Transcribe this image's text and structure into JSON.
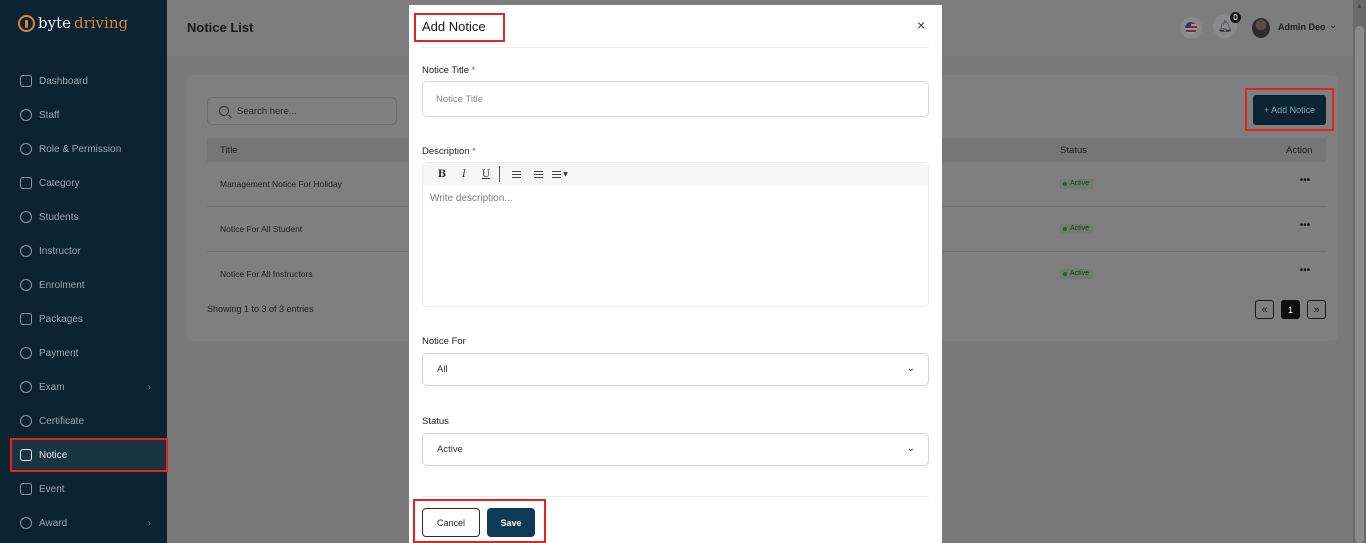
{
  "app": {
    "brand_part1": "byte",
    "brand_part2": "driving"
  },
  "sidebar": {
    "items": [
      {
        "label": "Dashboard",
        "icon": "grid-icon"
      },
      {
        "label": "Staff",
        "icon": "users-icon"
      },
      {
        "label": "Role & Permission",
        "icon": "shield-icon"
      },
      {
        "label": "Category",
        "icon": "briefcase-icon"
      },
      {
        "label": "Students",
        "icon": "group-icon"
      },
      {
        "label": "Instructor",
        "icon": "user-icon"
      },
      {
        "label": "Enrolment",
        "icon": "copyright-icon"
      },
      {
        "label": "Packages",
        "icon": "layers-icon"
      },
      {
        "label": "Payment",
        "icon": "dollar-icon"
      },
      {
        "label": "Exam",
        "icon": "exam-icon",
        "has_submenu": true
      },
      {
        "label": "Certificate",
        "icon": "badge-icon"
      },
      {
        "label": "Notice",
        "icon": "notice-icon",
        "active": true
      },
      {
        "label": "Event",
        "icon": "calendar-icon"
      },
      {
        "label": "Award",
        "icon": "award-icon",
        "has_submenu": true
      }
    ]
  },
  "header": {
    "page_title": "Notice List",
    "notification_count": "0",
    "user_name": "Admin Deo"
  },
  "list": {
    "search_placeholder": "Search here...",
    "add_button": "+ Add Notice",
    "columns": {
      "title": "Title",
      "status": "Status",
      "action": "Action"
    },
    "rows": [
      {
        "title": "Management Notice For Holiday",
        "status": "Active"
      },
      {
        "title": "Notice For All Student",
        "status": "Active"
      },
      {
        "title": "Notice For All Instructors",
        "status": "Active"
      }
    ],
    "showing": "Showing 1 to 3 of 3 entries",
    "pagination": {
      "prev": "«",
      "current": "1",
      "next": "»"
    }
  },
  "modal": {
    "title": "Add Notice",
    "close": "×",
    "notice_title_label": "Notice Title",
    "notice_title_placeholder": "Notice Title",
    "description_label": "Description",
    "description_placeholder": "Write description...",
    "required_mark": "*",
    "toolbar": {
      "bold": "B",
      "italic": "I",
      "underline": "U"
    },
    "notice_for_label": "Notice For",
    "notice_for_value": "All",
    "status_label": "Status",
    "status_value": "Active",
    "cancel_button": "Cancel",
    "save_button": "Save"
  },
  "colors": {
    "sidebar_bg": "#0c2331",
    "primary": "#0e3a57",
    "highlight": "#e32222",
    "brand_accent": "#d9823a"
  }
}
